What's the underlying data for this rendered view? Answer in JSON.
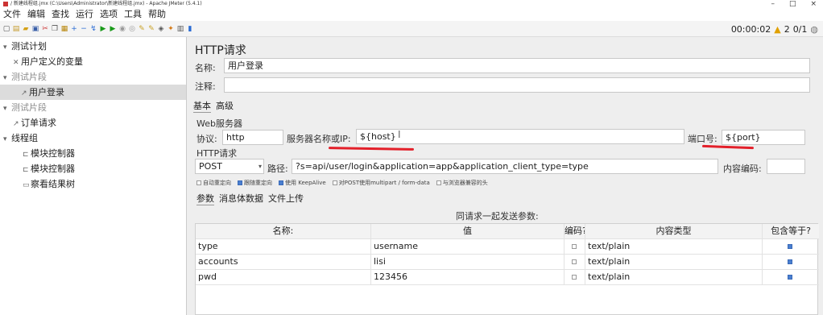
{
  "window": {
    "title": "/ 新建线程组.jmx (C:\\Users\\Administrator\\新建线程组.jmx) - Apache JMeter (5.4.1)",
    "controls": [
      "–",
      "□",
      "×"
    ]
  },
  "menu": [
    "文件",
    "编辑",
    "查找",
    "运行",
    "选项",
    "工具",
    "帮助"
  ],
  "toolbar": {
    "icons": [
      "new-icon",
      "templates-icon",
      "open-icon",
      "save-icon",
      "cut-icon",
      "copy-icon",
      "paste-icon",
      "expand-icon",
      "collapse-icon",
      "toggle-icon",
      "start-icon",
      "start-no-pause-icon",
      "stop-icon",
      "shutdown-icon",
      "clear-icon",
      "clear-all-icon",
      "search-icon",
      "reset-search-icon",
      "function-helper-icon",
      "help-icon"
    ],
    "timer": "00:00:02",
    "warnings": "2",
    "threads": "0/1"
  },
  "tree": [
    {
      "label": "测试计划",
      "glyph": "▾",
      "indent": 0
    },
    {
      "label": "用户定义的变量",
      "glyph": "✕",
      "indent": 1
    },
    {
      "label": "测试片段",
      "glyph": "▾",
      "indent": 1,
      "disabled": true
    },
    {
      "label": "用户登录",
      "glyph": "↗",
      "indent": 2,
      "selected": true
    },
    {
      "label": "测试片段",
      "glyph": "▾",
      "indent": 1,
      "disabled": true
    },
    {
      "label": "订单请求",
      "glyph": "↗",
      "indent": 2
    },
    {
      "label": "线程组",
      "glyph": "▾",
      "indent": 1
    },
    {
      "label": "模块控制器",
      "glyph": "⊏",
      "indent": 2
    },
    {
      "label": "模块控制器",
      "glyph": "⊏",
      "indent": 2
    },
    {
      "label": "察看结果树",
      "glyph": "▭",
      "indent": 2
    }
  ],
  "panel": {
    "title": "HTTP请求",
    "name_label": "名称:",
    "name_value": "用户登录",
    "comment_label": "注释:",
    "comment_value": "",
    "tabs": [
      "基本",
      "高级"
    ],
    "web_server_title": "Web服务器",
    "protocol_label": "协议:",
    "protocol_value": "http",
    "server_label": "服务器名称或IP:",
    "server_value": "${host}",
    "port_label": "端口号:",
    "port_value": "${port}",
    "http_request_title": "HTTP请求",
    "method": "POST",
    "path_label": "路径:",
    "path_value": "?s=api/user/login&application=app&application_client_type=type",
    "encoding_label": "内容编码:",
    "encoding_value": "",
    "options": [
      {
        "label": "自动重定向",
        "checked": false
      },
      {
        "label": "跟随重定向",
        "checked": true
      },
      {
        "label": "使用 KeepAlive",
        "checked": true
      },
      {
        "label": "对POST使用multipart / form-data",
        "checked": false
      },
      {
        "label": "与浏览器兼容的头",
        "checked": false
      }
    ],
    "param_tabs": [
      "参数",
      "消息体数据",
      "文件上传"
    ],
    "params_caption": "同请求一起发送参数:",
    "columns": [
      "名称:",
      "值",
      "编码?",
      "内容类型",
      "包含等于?"
    ],
    "params": [
      {
        "name": "type",
        "value": "username",
        "encode": false,
        "content_type": "text/plain",
        "include_equals": true
      },
      {
        "name": "accounts",
        "value": "lisi",
        "encode": false,
        "content_type": "text/plain",
        "include_equals": true
      },
      {
        "name": "pwd",
        "value": "123456",
        "encode": false,
        "content_type": "text/plain",
        "include_equals": true
      }
    ]
  },
  "colors": {
    "annotation_underline": "#e3202a",
    "checkbox_checked": "#4a7fd0",
    "selected_row": "#dcdcdc"
  }
}
